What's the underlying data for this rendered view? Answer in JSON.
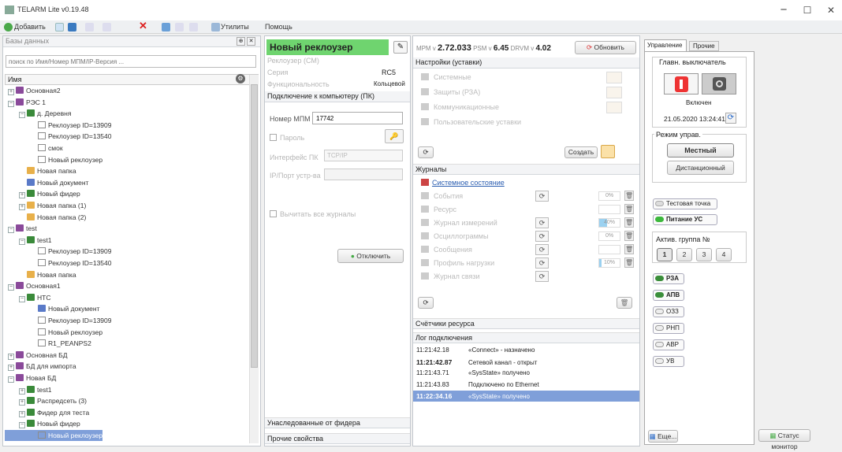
{
  "window": {
    "title": "TELARM Lite v0.19.48",
    "minimize": "−",
    "maximize": "☐",
    "close": "✕"
  },
  "toolbar": {
    "add": "Добавить",
    "utilities": "Утилиты",
    "help": "Помощь"
  },
  "left": {
    "header": "Базы данных",
    "search_placeholder": "поиск по Имя/Номер МПМ/IP-Версия ...",
    "column": "Имя",
    "tree": [
      {
        "label": "Основная2",
        "level": 0,
        "icon": "db",
        "exp": "+"
      },
      {
        "label": "РЭС 1",
        "level": 0,
        "icon": "db",
        "exp": "−"
      },
      {
        "label": "д. Деревня",
        "level": 1,
        "icon": "node",
        "exp": "−"
      },
      {
        "label": "Реклоузер ID=13909",
        "level": 2,
        "icon": "rec"
      },
      {
        "label": "Реклоузер ID=13540",
        "level": 2,
        "icon": "rec"
      },
      {
        "label": "смок",
        "level": 2,
        "icon": "rec"
      },
      {
        "label": "Новый реклоузер",
        "level": 2,
        "icon": "rec"
      },
      {
        "label": "Новая папка",
        "level": 1,
        "icon": "folder"
      },
      {
        "label": "Новый документ",
        "level": 1,
        "icon": "doc"
      },
      {
        "label": "Новый фидер",
        "level": 1,
        "icon": "node",
        "exp": "+"
      },
      {
        "label": "Новая папка (1)",
        "level": 1,
        "icon": "folder",
        "exp": "+"
      },
      {
        "label": "Новая папка (2)",
        "level": 1,
        "icon": "folder"
      },
      {
        "label": "test",
        "level": 0,
        "icon": "db",
        "exp": "−"
      },
      {
        "label": "test1",
        "level": 1,
        "icon": "node",
        "exp": "−"
      },
      {
        "label": "Реклоузер ID=13909",
        "level": 2,
        "icon": "rec"
      },
      {
        "label": "Реклоузер ID=13540",
        "level": 2,
        "icon": "rec"
      },
      {
        "label": "Новая папка",
        "level": 1,
        "icon": "folder"
      },
      {
        "label": "Основная1",
        "level": 0,
        "icon": "db",
        "exp": "−"
      },
      {
        "label": "НТС",
        "level": 1,
        "icon": "node",
        "exp": "−"
      },
      {
        "label": "Новый документ",
        "level": 2,
        "icon": "doc"
      },
      {
        "label": "Реклоузер ID=13909",
        "level": 2,
        "icon": "rec"
      },
      {
        "label": "Новый реклоузер",
        "level": 2,
        "icon": "rec"
      },
      {
        "label": "R1_PEANPS2",
        "level": 2,
        "icon": "rec"
      },
      {
        "label": "Основная БД",
        "level": 0,
        "icon": "db",
        "exp": "+"
      },
      {
        "label": "БД для импорта",
        "level": 0,
        "icon": "db",
        "exp": "+"
      },
      {
        "label": "Новая БД",
        "level": 0,
        "icon": "db",
        "exp": "−"
      },
      {
        "label": "test1",
        "level": 1,
        "icon": "node",
        "exp": "+"
      },
      {
        "label": "Распредсеть (3)",
        "level": 1,
        "icon": "node",
        "exp": "+"
      },
      {
        "label": "Фидер для теста",
        "level": 1,
        "icon": "node",
        "exp": "+"
      },
      {
        "label": "Новый фидер",
        "level": 1,
        "icon": "node",
        "exp": "−"
      },
      {
        "label": "Новый реклоузер",
        "level": 2,
        "icon": "rec",
        "selected": true
      }
    ]
  },
  "props": {
    "title": "Новый реклоузер",
    "subtitle": "Реклоузер (СМ)",
    "series_label": "Серия",
    "series_value": "RC5",
    "func_label": "Функциональность",
    "func_value": "Кольцевой",
    "conn_header": "Подключение к компьютеру (ПК)",
    "mpm_label": "Номер МПМ",
    "mpm_value": "17742",
    "password_label": "Пароль",
    "protocol_label": "Интерфейс ПК",
    "protocol_value": "TCP/IP",
    "ip_label": "IP/Порт устр-ва",
    "read_all_label": "Вычитать все журналы",
    "disconnect": "Отключить",
    "inherited": "Унаследованные от фидера",
    "other_props": "Прочие свойства"
  },
  "mid": {
    "mpm_label": "МРМ v",
    "mpm_ver": "2.72.033",
    "psm_label": "PSM v",
    "psm_ver": "6.45",
    "drvm_label": "DRVM v",
    "drvm_ver": "4.02",
    "refresh": "Обновить",
    "settings_header": "Настройки (уставки)",
    "settings": [
      "Системные",
      "Защиты (РЗА)",
      "Коммуникационные",
      "Пользовательские уставки"
    ],
    "create": "Создать",
    "journals_header": "Журналы",
    "sys_state": "Системное состояние",
    "journals": [
      "События",
      "Ресурс",
      "Журнал измерений",
      "Осциллограммы",
      "Сообщения",
      "Профиль нагрузки",
      "Журнал связи"
    ],
    "journal_pcts": [
      "0%",
      "",
      "40%",
      "0%",
      "",
      "10%",
      ""
    ],
    "counters": "Счётчики ресурса",
    "log_header": "Лог подключения",
    "log": [
      {
        "time": "11:21:42.18",
        "msg": "«Connect» - назначено",
        "bold": false,
        "sel": false
      },
      {
        "time": "11:21:42.87",
        "msg": "Сетевой канал - открыт",
        "bold": true,
        "sel": false
      },
      {
        "time": "11:21:43.71",
        "msg": "«SysState» получено",
        "bold": false,
        "sel": false
      },
      {
        "time": "11:21:43.83",
        "msg": "Подключено по Ethernet",
        "bold": false,
        "sel": false
      },
      {
        "time": "11:22:34.16",
        "msg": "«SysState» получено",
        "bold": true,
        "sel": true
      }
    ]
  },
  "right": {
    "tab_control": "Управление",
    "tab_other": "Прочие",
    "main_switch": "Главн. выключатель",
    "switch_state": "Включен",
    "datetime": "21.05.2020 13:24:41",
    "mode_label": "Режим управ.",
    "local": "Местный",
    "remote": "Дистанционный",
    "test_point": "Тестовая точка",
    "power": "Питание УС",
    "active_group": "Актив. группа №",
    "groups": [
      "1",
      "2",
      "3",
      "4"
    ],
    "toggles": [
      {
        "label": "РЗА",
        "on": true
      },
      {
        "label": "АПВ",
        "on": true
      },
      {
        "label": "ОЗЗ",
        "on": false
      },
      {
        "label": "РНП",
        "on": false
      },
      {
        "label": "АВР",
        "on": false
      },
      {
        "label": "УВ",
        "on": false
      }
    ],
    "more": "Еще...",
    "status_monitor": "Статус монитор"
  },
  "colors": {
    "accent": "#3a8e3a",
    "selected": "#7f9fd9",
    "title_bar": "#6cc86c"
  }
}
